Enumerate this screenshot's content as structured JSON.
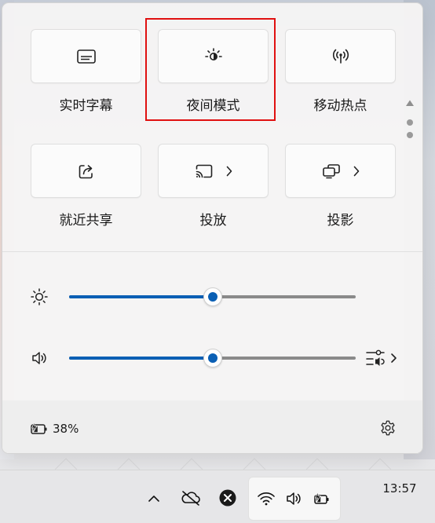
{
  "quick_settings": {
    "tiles": [
      {
        "label": "实时字幕",
        "icon": "live-captions-icon"
      },
      {
        "label": "夜间模式",
        "icon": "night-light-icon"
      },
      {
        "label": "移动热点",
        "icon": "mobile-hotspot-icon"
      },
      {
        "label": "就近共享",
        "icon": "nearby-share-icon"
      },
      {
        "label": "投放",
        "icon": "cast-icon",
        "has_chevron": true
      },
      {
        "label": "投影",
        "icon": "project-icon",
        "has_chevron": true
      }
    ],
    "highlighted_tile": "夜间模式",
    "pages": {
      "count": 2,
      "current": 1
    }
  },
  "sliders": {
    "brightness": {
      "icon": "brightness-icon",
      "level": 0.5
    },
    "volume": {
      "icon": "volume-icon",
      "level": 0.5
    }
  },
  "footer": {
    "battery_percent": "38%",
    "battery_icon": "battery-charging-icon",
    "settings_icon": "settings-gear-icon"
  },
  "taskbar": {
    "tray_icons": [
      "chevron-up-icon",
      "onedrive-offline-icon",
      "close-circle-icon"
    ],
    "status_icons": [
      "wifi-icon",
      "volume-icon",
      "battery-charging-icon"
    ],
    "time": "13:57"
  },
  "colors": {
    "accent": "#0a5fb4",
    "highlight": "#e01010",
    "panel_bg": "#f5f4f4",
    "tile_bg": "#fbfbfb"
  }
}
